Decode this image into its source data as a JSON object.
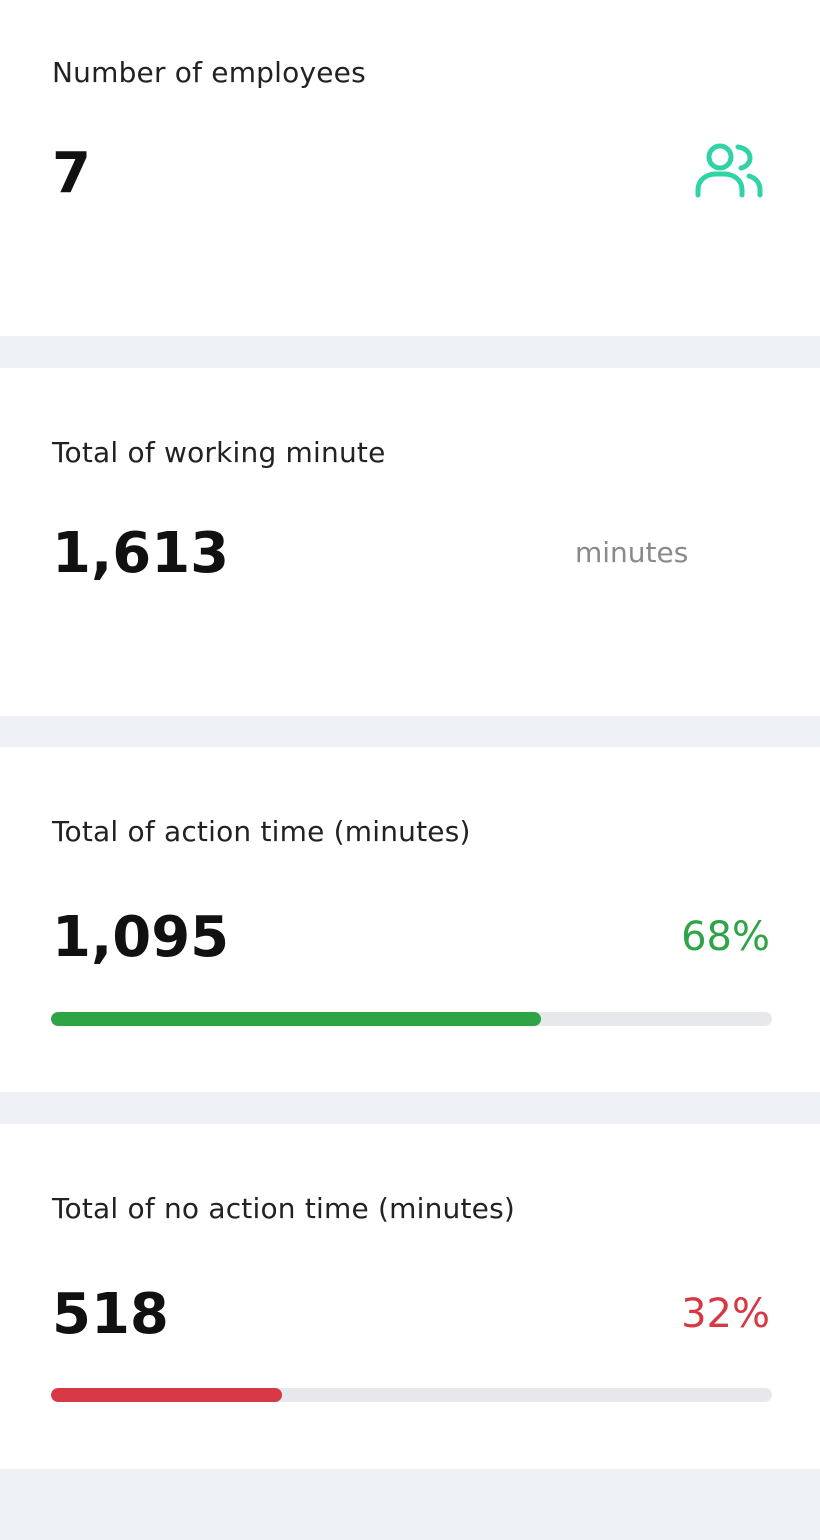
{
  "cards": {
    "employees": {
      "title": "Number of employees",
      "value": "7",
      "icon": "users-icon",
      "icon_color": "#2fd3a6"
    },
    "working": {
      "title": "Total of working minute",
      "value": "1,613",
      "unit": "minutes"
    },
    "action": {
      "title": "Total of action time (minutes)",
      "value": "1,095",
      "percent_label": "68%",
      "progress": 0.68,
      "color": "#2ea447"
    },
    "no_action": {
      "title": "Total of no action time (minutes)",
      "value": "518",
      "percent_label": "32%",
      "progress": 0.32,
      "color": "#d73944"
    }
  }
}
